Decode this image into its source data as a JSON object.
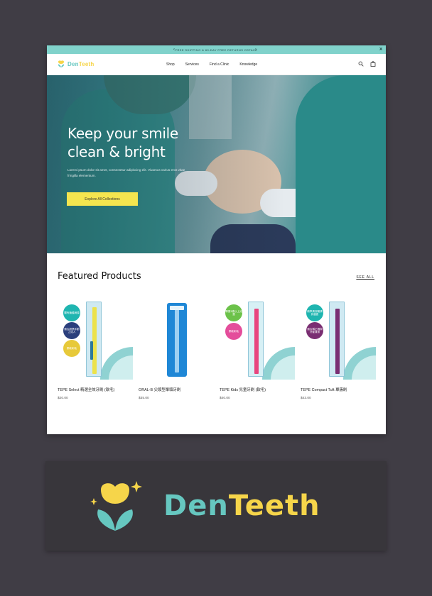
{
  "announcement": {
    "text": "FREE SHIPPING & 60-DAY FREE RETURNS OSTACE",
    "prev_icon": "chevron-left-icon",
    "next_icon": "chevron-right-icon",
    "close_icon": "close-icon"
  },
  "header": {
    "logo": {
      "part1": "Den",
      "part2": "Teeth"
    },
    "nav": [
      "Shop",
      "Services",
      "Find a Clinic",
      "Knowledge"
    ],
    "search_icon": "search-icon",
    "cart_icon": "bag-icon"
  },
  "hero": {
    "title": "Keep your smile clean & bright",
    "body": "Lorem ipsum dolor sit amet, consectetur adipiscing elit. Vivamus varius eros vitae fringilla elementum.",
    "cta_label": "Explore All Collections"
  },
  "featured": {
    "title": "Featured Products",
    "see_all": "SEE ALL",
    "products": [
      {
        "name": "TEPE Select 精選全效牙刷 (軟毛)",
        "price": "$20.00",
        "badges": [
          "獨有鎖護刷頭",
          "適合超慣手動之成人",
          "柔軟刷毛"
        ]
      },
      {
        "name": "ORAL-B 尖頭型單頭牙刷",
        "price": "$35.00",
        "badges": []
      },
      {
        "name": "TEPE Kids 兒童牙刷 (軟毛)",
        "price": "$40.00",
        "badges": [
          "專業3歲以上兒童",
          "柔軟刷毛"
        ]
      },
      {
        "name": "TEPE Compact Tuft 單簇刷",
        "price": "$43.00",
        "badges": [
          "精準清潔難清到齒區",
          "適合矯正器與牙套清潔"
        ]
      }
    ]
  },
  "banner": {
    "brand_part1": "Den",
    "brand_part2": "Teeth"
  },
  "colors": {
    "accent_teal": "#80d2cb",
    "brand_teal": "#66c7c0",
    "brand_yellow": "#f6d54a",
    "cta_yellow": "#f4e54f",
    "page_background": "#403d45"
  }
}
